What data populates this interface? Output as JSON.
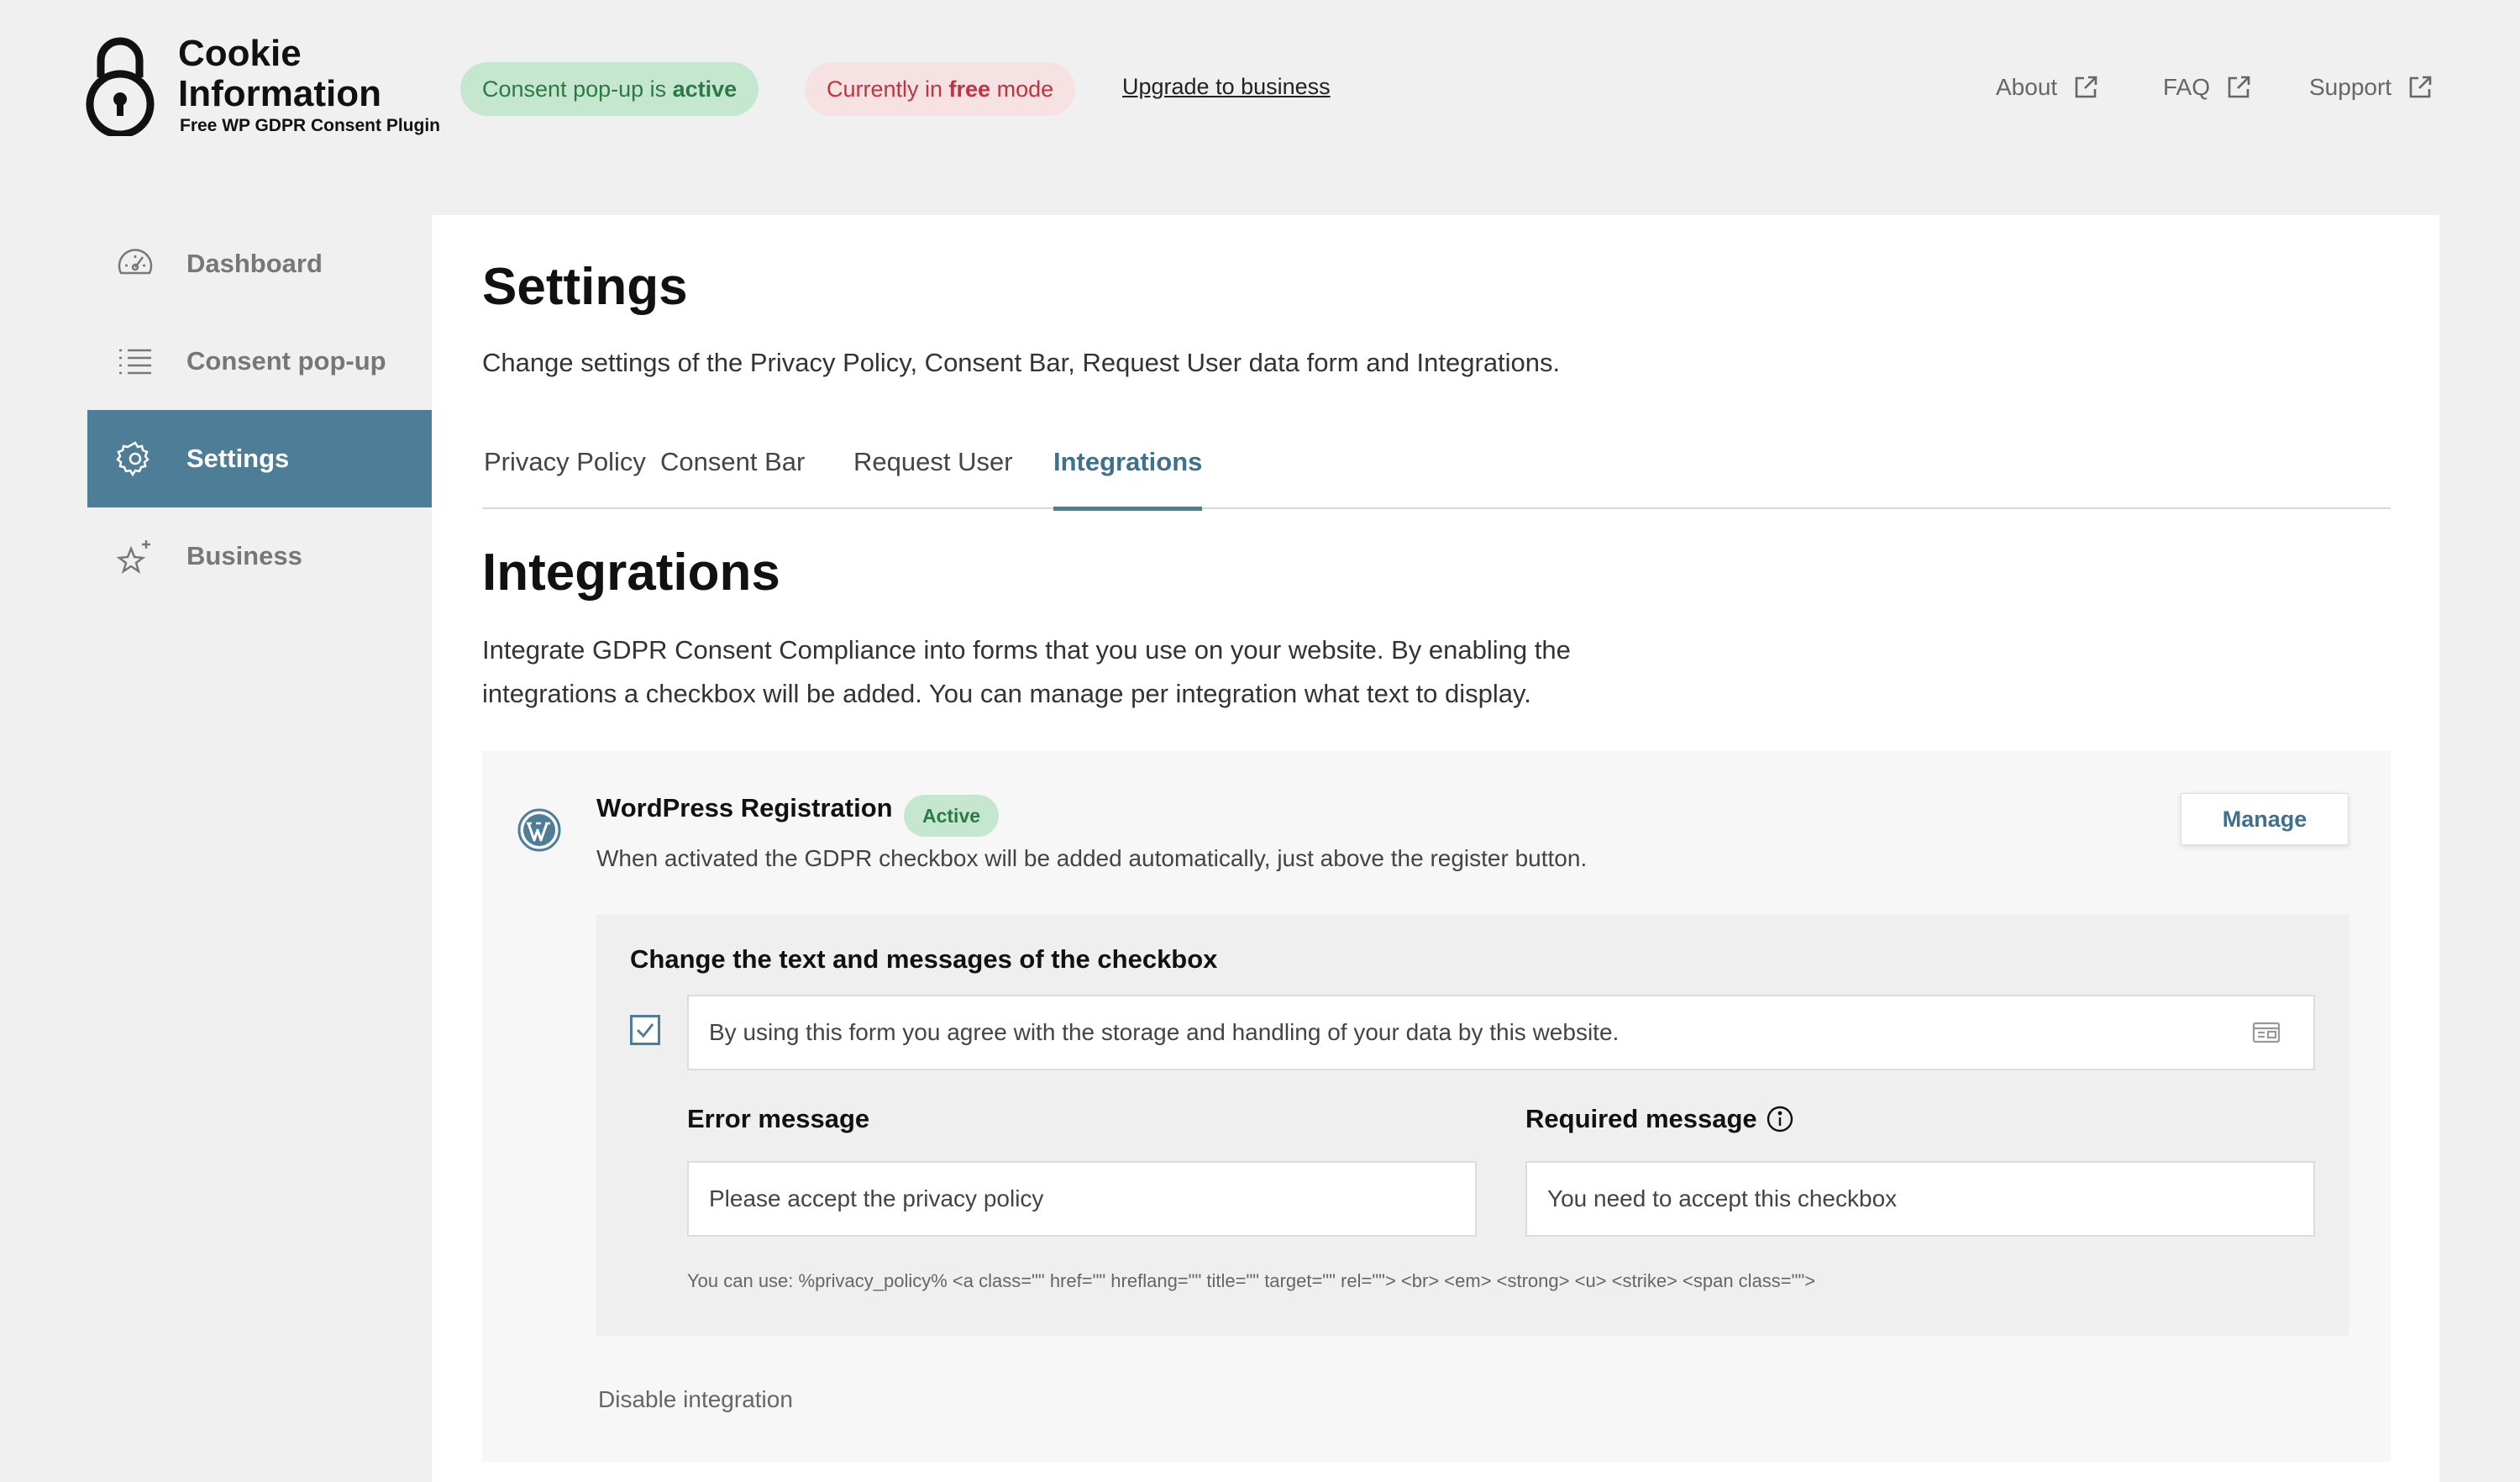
{
  "brand": {
    "title": "Cookie Information",
    "subtitle": "Free WP GDPR Consent Plugin"
  },
  "header": {
    "status_active_prefix": "Consent pop-up is ",
    "status_active_bold": "active",
    "mode_prefix": "Currently in ",
    "mode_bold": "free",
    "mode_suffix": " mode",
    "upgrade_label": "Upgrade to business",
    "links": [
      {
        "label": "About",
        "icon": "external-link-icon"
      },
      {
        "label": "FAQ",
        "icon": "external-link-icon"
      },
      {
        "label": "Support",
        "icon": "external-link-icon"
      }
    ]
  },
  "sidebar": {
    "items": [
      {
        "label": "Dashboard",
        "icon": "dashboard-icon",
        "active": false
      },
      {
        "label": "Consent pop-up",
        "icon": "list-icon",
        "active": false
      },
      {
        "label": "Settings",
        "icon": "gear-icon",
        "active": true
      },
      {
        "label": "Business",
        "icon": "sparkle-star-icon",
        "active": false
      }
    ]
  },
  "main": {
    "title": "Settings",
    "description": "Change settings of the Privacy Policy, Consent Bar, Request User data form and Integrations.",
    "tabs": [
      {
        "label": "Privacy Policy",
        "active": false
      },
      {
        "label": "Consent Bar",
        "active": false
      },
      {
        "label": "Request User",
        "active": false
      },
      {
        "label": "Integrations",
        "active": true
      }
    ],
    "section_title": "Integrations",
    "section_description": "Integrate GDPR Consent Compliance into forms that you use on your website. By enabling the integrations a checkbox will be added. You can manage per integration what text to display."
  },
  "integration": {
    "name": "WordPress Registration",
    "status": "Active",
    "description": "When activated the GDPR checkbox will be added automatically, just above the register button.",
    "manage_label": "Manage",
    "icon": "wordpress-icon",
    "checkbox_section": {
      "title": "Change the text and messages of the checkbox",
      "checked": true,
      "checkbox_text": "By using this form you agree with the storage and handling of your data by this website.",
      "error_label": "Error message",
      "error_value": "Please accept the privacy policy",
      "required_label": "Required message",
      "required_value": "You need to accept this checkbox",
      "allowed_tags": "You can use: %privacy_policy% <a class=\"\" href=\"\" hreflang=\"\" title=\"\" target=\"\" rel=\"\"> <br> <em> <strong> <u> <strike> <span class=\"\">"
    },
    "disable_label": "Disable integration"
  },
  "colors": {
    "accent": "#4d7d97",
    "accent_text": "#3f718e",
    "success_bg": "#c6e7cf",
    "success_text": "#2b7a45",
    "danger_bg": "#f7e2e3",
    "danger_text": "#c0333f",
    "page_bg": "#f0f0f0"
  }
}
